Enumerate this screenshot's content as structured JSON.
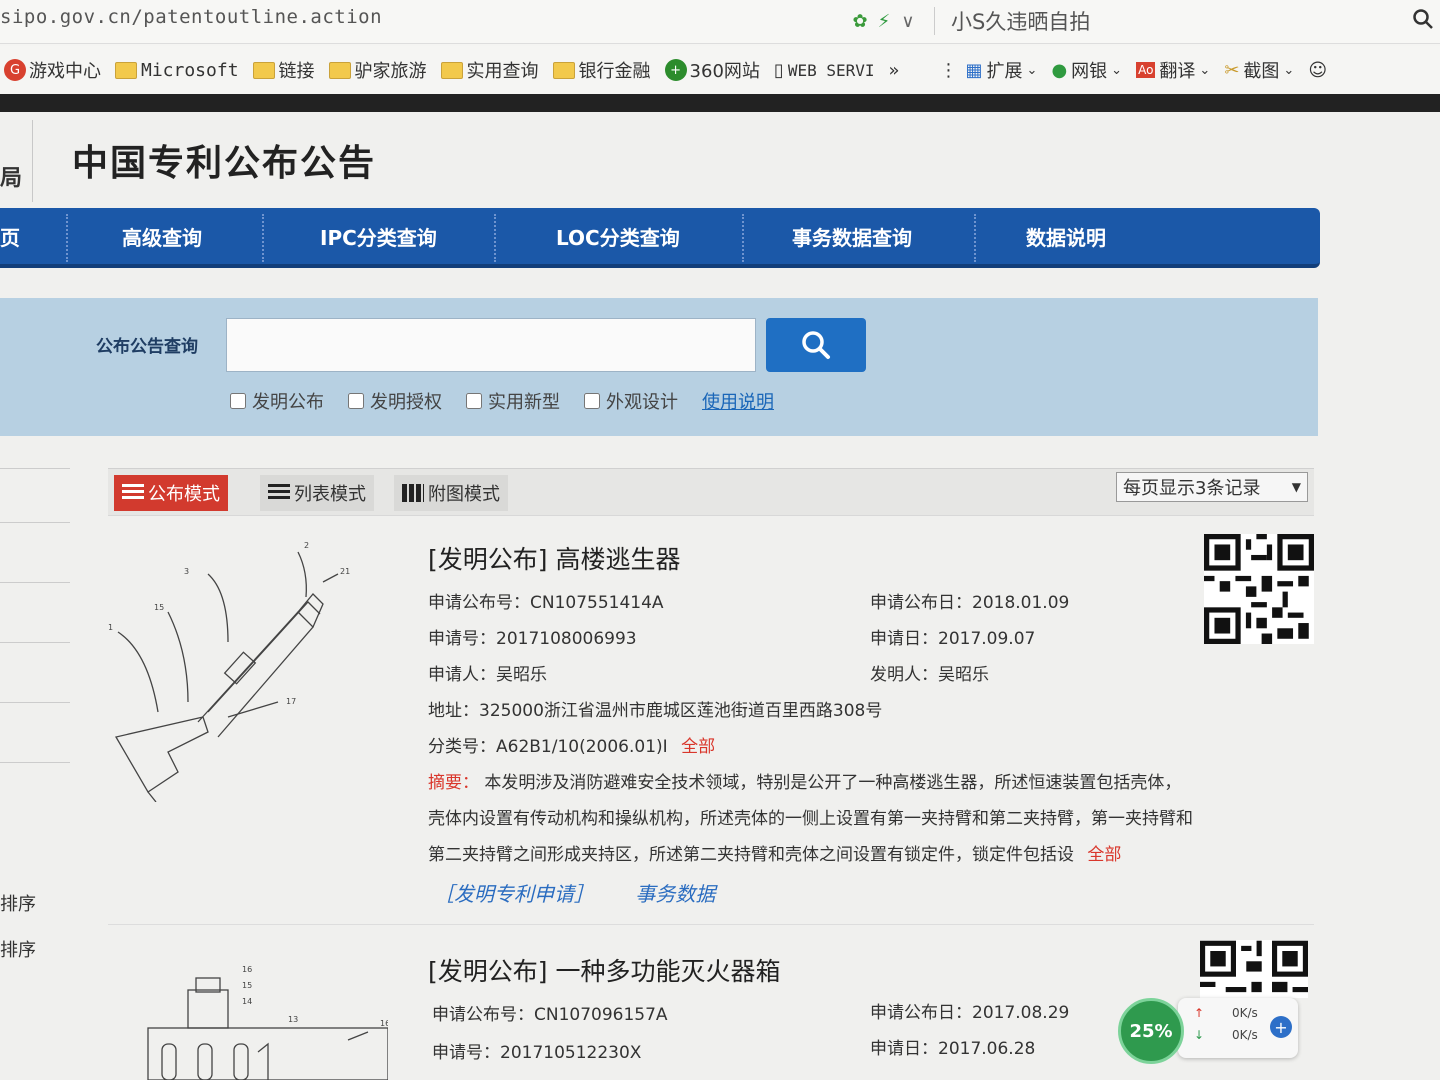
{
  "browser": {
    "url": "sipo.gov.cn/patentoutline.action",
    "news_text": "小S久违晒自拍",
    "bookmarks": [
      "游戏中心",
      "Microsoft",
      "链接",
      "驴家旅游",
      "实用查询",
      "银行金融",
      "360网站",
      "WEB SERVI",
      "»"
    ],
    "extensions": [
      "扩展",
      "网银",
      "翻译",
      "截图"
    ]
  },
  "site": {
    "logo_text": "局",
    "title": "中国专利公布公告"
  },
  "nav": {
    "items": [
      "页",
      "高级查询",
      "IPC分类查询",
      "LOC分类查询",
      "事务数据查询",
      "数据说明"
    ]
  },
  "search": {
    "label": "公布公告查询",
    "input_value": "",
    "checkboxes": [
      "发明公布",
      "发明授权",
      "实用新型",
      "外观设计"
    ],
    "help_link": "使用说明"
  },
  "left_sort": [
    "排序",
    "排序"
  ],
  "modes": {
    "items": [
      "公布模式",
      "列表模式",
      "附图模式"
    ],
    "active": "公布模式",
    "per_page": "每页显示3条记录"
  },
  "records": [
    {
      "title": "[发明公布] 高楼逃生器",
      "pub_no": "申请公布号：CN107551414A",
      "pub_date": "申请公布日：2018.01.09",
      "app_no": "申请号：2017108006993",
      "app_date": "申请日：2017.09.07",
      "applicant": "申请人：吴昭乐",
      "inventor": "发明人：吴昭乐",
      "address": "地址：325000浙江省温州市鹿城区莲池街道百里西路308号",
      "class_no": "分类号：A62B1/10(2006.01)I",
      "class_all": "全部",
      "abstract_label": "摘要：",
      "abstract_lines": [
        "本发明涉及消防避难安全技术领域，特别是公开了一种高楼逃生器，所述恒速装置包括壳体，",
        "壳体内设置有传动机构和操纵机构，所述壳体的一侧上设置有第一夹持臂和第二夹持臂，第一夹持臂和",
        "第二夹持臂之间形成夹持区，所述第二夹持臂和壳体之间设置有锁定件，锁定件包括设"
      ],
      "abstract_all": "全部",
      "link1": "［发明专利申请］",
      "link2": "事务数据"
    },
    {
      "title": "[发明公布] 一种多功能灭火器箱",
      "pub_no": "申请公布号：CN107096157A",
      "pub_date": "申请公布日：2017.08.29",
      "app_no": "申请号：201710512230X",
      "app_date": "申请日：2017.06.28"
    }
  ],
  "speed_widget": {
    "percent": "25%",
    "up": "0K/s",
    "down": "0K/s"
  }
}
